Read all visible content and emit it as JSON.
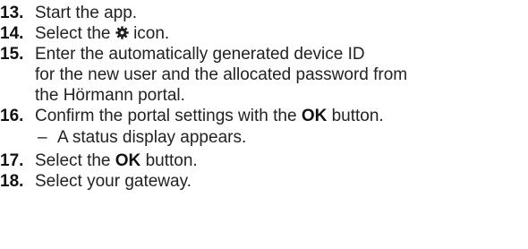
{
  "steps": [
    {
      "number": "13.",
      "text": "Start the app."
    },
    {
      "number": "14.",
      "text_before": "Select the",
      "icon": "gear-icon",
      "text_after": "icon."
    },
    {
      "number": "15.",
      "lines": [
        "Enter the automatically generated device ID",
        "for the new user and the allocated password from",
        "the Hörmann portal."
      ]
    },
    {
      "number": "16.",
      "text_before": "Confirm the portal settings with the",
      "bold": "OK",
      "text_after": "button.",
      "sub": {
        "dash": "–",
        "text": "A status display appears."
      }
    },
    {
      "number": "17.",
      "text_before": "Select the",
      "bold": "OK",
      "text_after": "button."
    },
    {
      "number": "18.",
      "text": "Select your gateway."
    }
  ]
}
